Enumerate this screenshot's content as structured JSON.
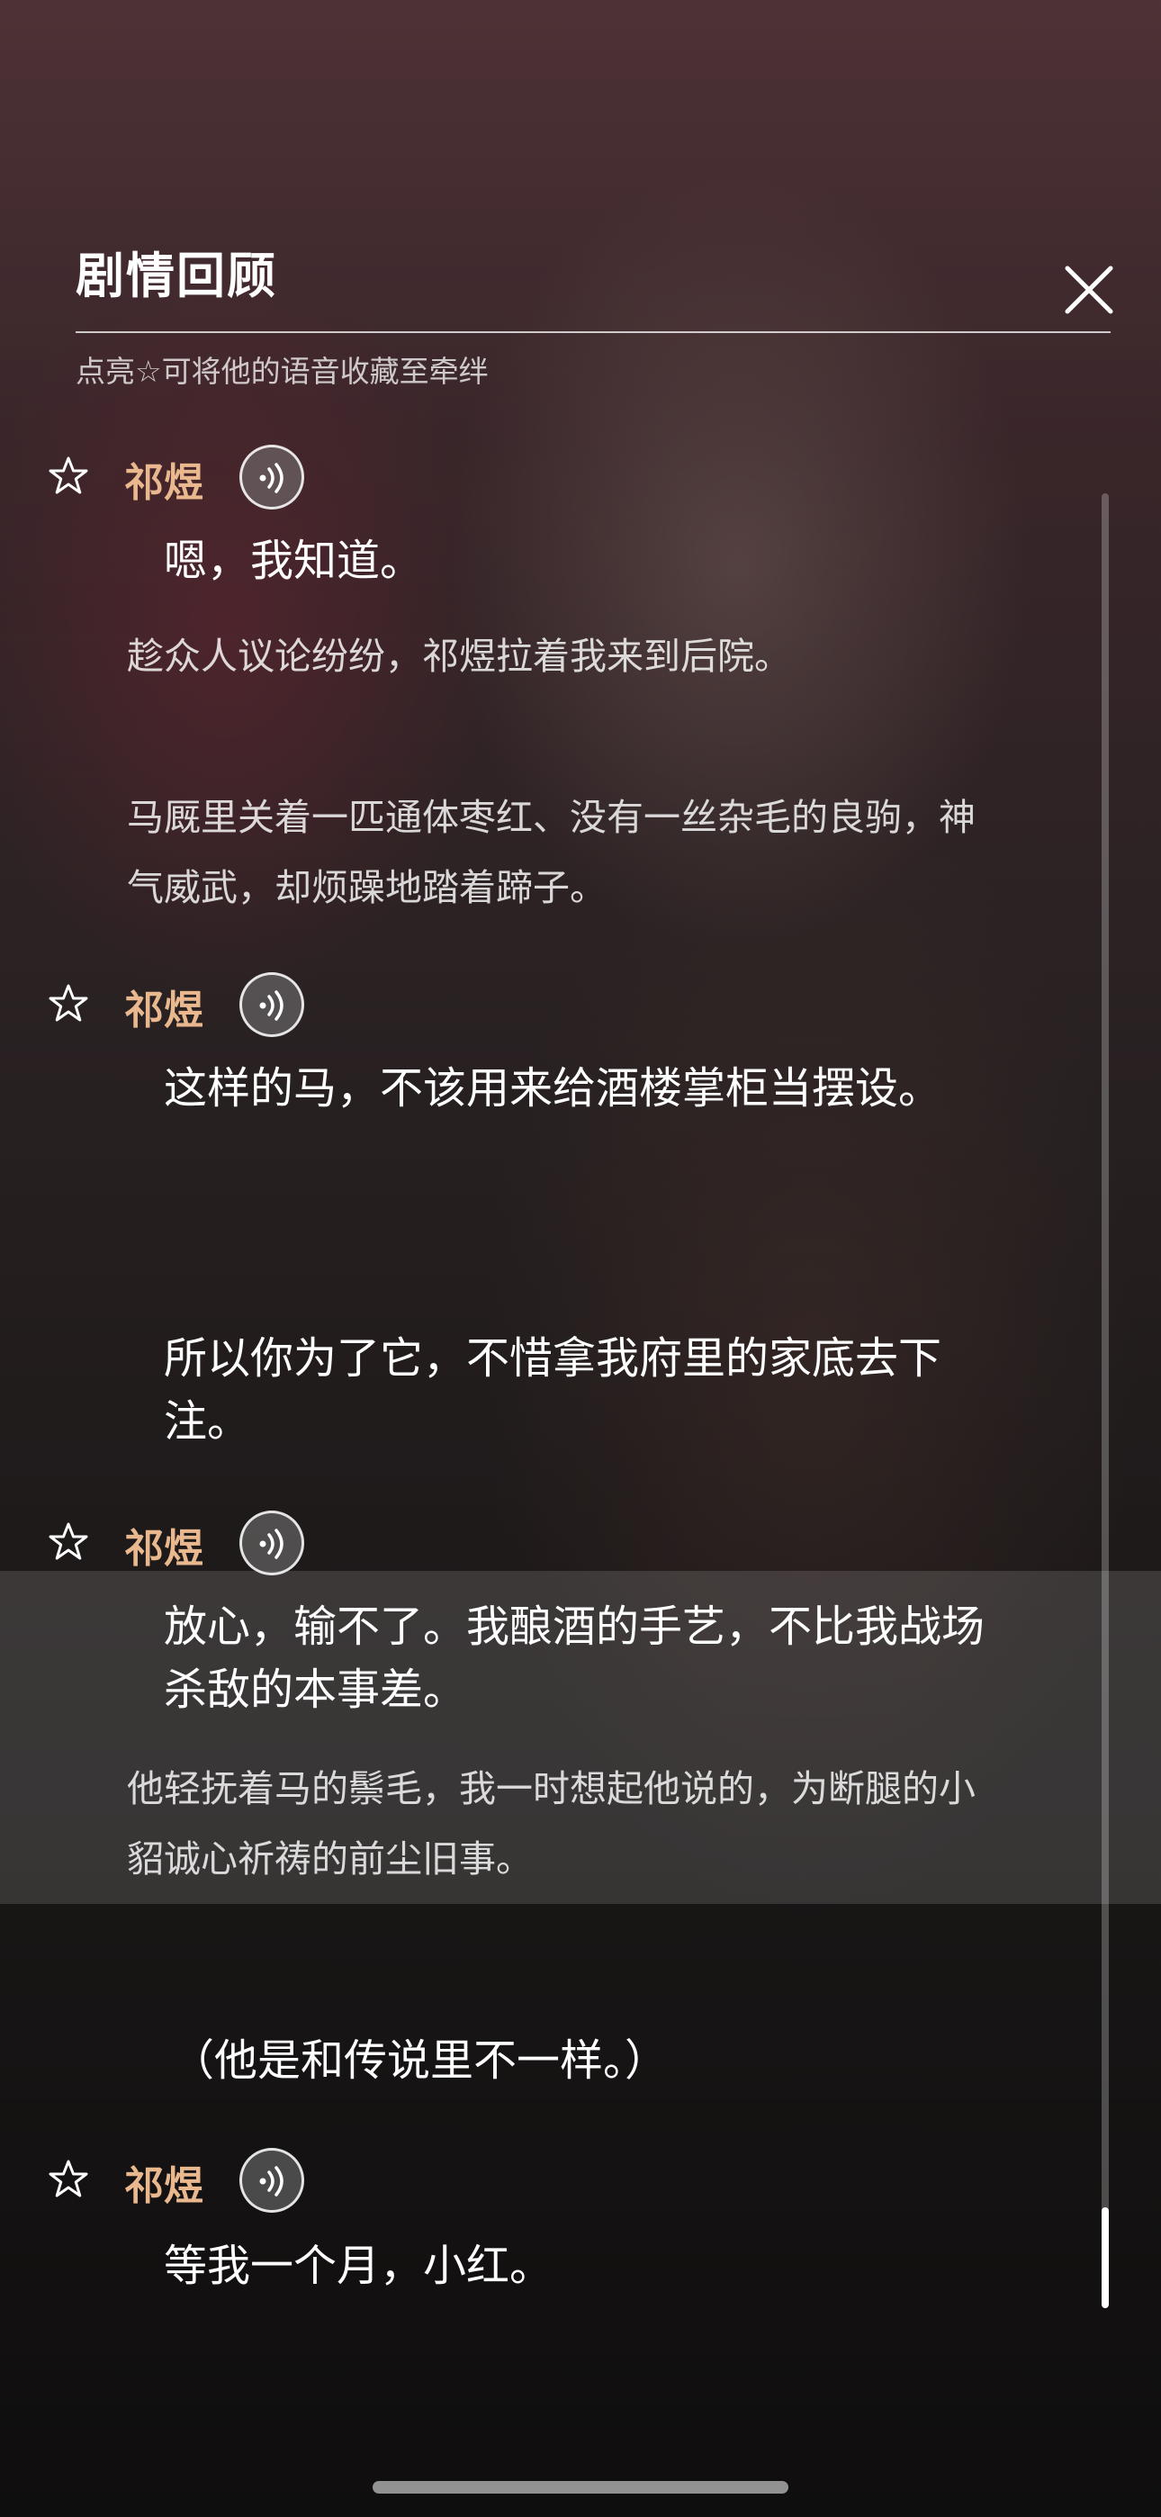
{
  "header": {
    "title": "剧情回顾",
    "hint": "点亮☆可将他的语音收藏至牵绊"
  },
  "icons": {
    "close": "close-icon",
    "favorite": "star-outline-icon",
    "voice": "voice-playback-icon"
  },
  "colors": {
    "speaker_name": "#e9b88e"
  },
  "dialogue": [
    {
      "type": "speech",
      "speaker": "祁煜",
      "text": "嗯，我知道。"
    },
    {
      "type": "narration",
      "text": "趁众人议论纷纷，祁煜拉着我来到后院。"
    },
    {
      "type": "narration",
      "text": "马厩里关着一匹通体枣红、没有一丝杂毛的良驹，神气威武，却烦躁地踏着蹄子。"
    },
    {
      "type": "speech",
      "speaker": "祁煜",
      "text": "这样的马，不该用来给酒楼掌柜当摆设。"
    },
    {
      "type": "speech",
      "speaker": "",
      "text": "所以你为了它，不惜拿我府里的家底去下注。"
    },
    {
      "type": "speech",
      "speaker": "祁煜",
      "text": "放心，输不了。我酿酒的手艺，不比我战场杀敌的本事差。"
    },
    {
      "type": "narration",
      "text": "他轻抚着马的鬃毛，我一时想起他说的，为断腿的小貂诚心祈祷的前尘旧事。"
    },
    {
      "type": "speech",
      "speaker": "",
      "text": "（他是和传说里不一样。）"
    },
    {
      "type": "speech",
      "speaker": "祁煜",
      "text": "等我一个月，小红。"
    }
  ]
}
